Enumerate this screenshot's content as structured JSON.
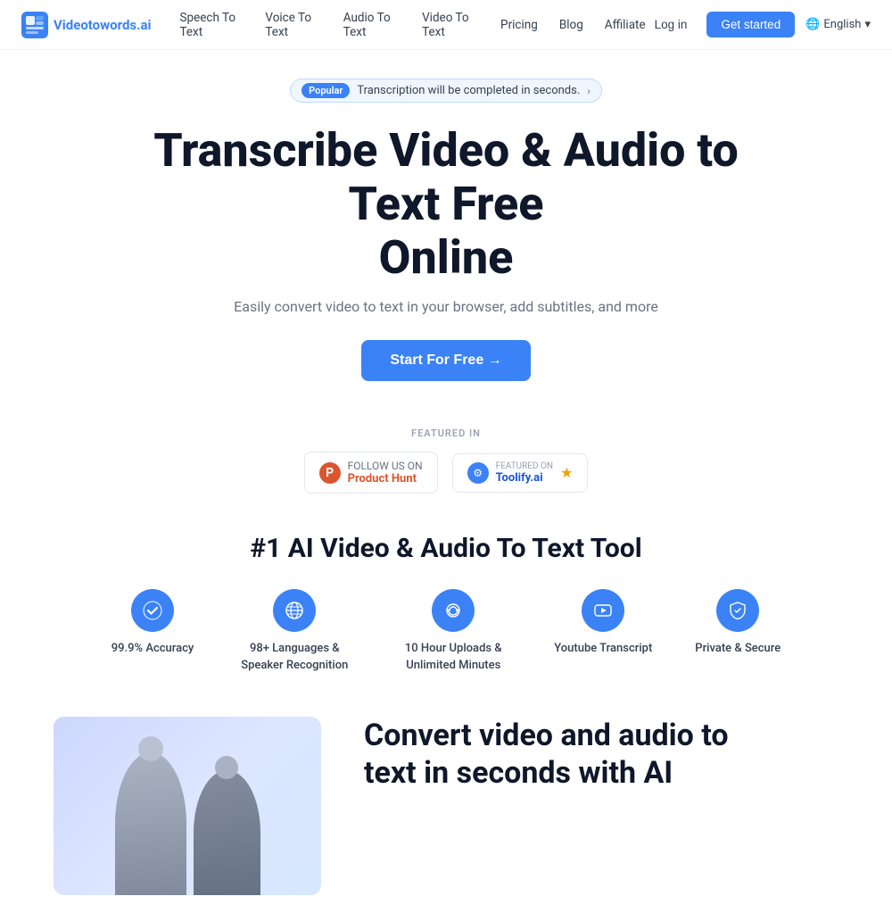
{
  "meta": {
    "title": "Videotowords.ai"
  },
  "navbar": {
    "logo_text_main": "Videotowords",
    "logo_text_accent": ".ai",
    "links": [
      {
        "label": "Speech To Text",
        "id": "speech-to-text"
      },
      {
        "label": "Voice To Text",
        "id": "voice-to-text"
      },
      {
        "label": "Audio To Text",
        "id": "audio-to-text"
      },
      {
        "label": "Video To Text",
        "id": "video-to-text"
      },
      {
        "label": "Pricing",
        "id": "pricing"
      },
      {
        "label": "Blog",
        "id": "blog"
      },
      {
        "label": "Affiliate",
        "id": "affiliate"
      }
    ],
    "login_label": "Log in",
    "get_started_label": "Get started",
    "language_label": "English"
  },
  "hero": {
    "popular_tag": "Popular",
    "popular_text": "Transcription will be completed in seconds.",
    "title_line1": "Transcribe Video & Audio to Text Free",
    "title_line2": "Online",
    "subtitle": "Easily convert video to text in your browser, add subtitles, and more",
    "cta_label": "Start For Free →"
  },
  "featured": {
    "label": "FEATURED IN",
    "product_hunt_follow": "FOLLOW US ON",
    "product_hunt_name": "Product Hunt",
    "toolify_featured": "FEATURED ON",
    "toolify_name": "Toolify.ai"
  },
  "features_section": {
    "title": "#1 AI Video & Audio To Text Tool",
    "items": [
      {
        "id": "accuracy",
        "icon": "✓",
        "label": "99.9% Accuracy"
      },
      {
        "id": "languages",
        "icon": "🌐",
        "label": "98+ Languages & Speaker Recognition"
      },
      {
        "id": "uploads",
        "icon": "∞",
        "label": "10 Hour Uploads & Unlimited Minutes"
      },
      {
        "id": "youtube",
        "icon": "▶",
        "label": "Youtube Transcript"
      },
      {
        "id": "secure",
        "icon": "🛡",
        "label": "Private & Secure"
      }
    ]
  },
  "bottom_section": {
    "title_line1": "Convert video and audio to",
    "title_line2": "text in seconds with AI"
  }
}
